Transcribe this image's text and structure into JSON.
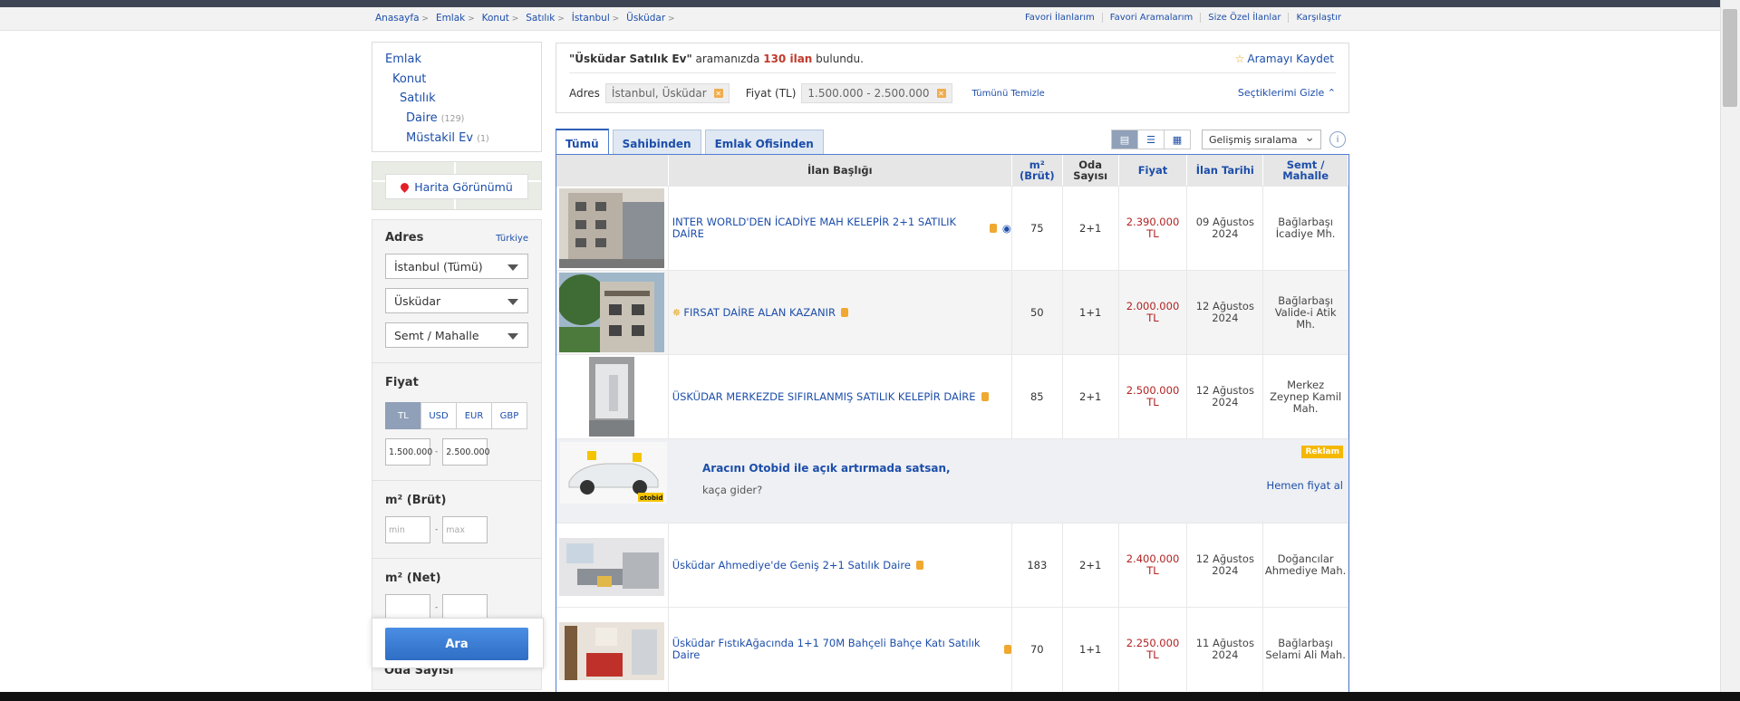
{
  "breadcrumbs": [
    "Anasayfa",
    "Emlak",
    "Konut",
    "Satılık",
    "İstanbul",
    "Üsküdar"
  ],
  "top_links": [
    "Favori İlanlarım",
    "Favori Aramalarım",
    "Size Özel İlanlar",
    "Karşılaştır"
  ],
  "sidebar": {
    "categories": [
      {
        "label": "Emlak",
        "count": ""
      },
      {
        "label": "Konut",
        "count": ""
      },
      {
        "label": "Satılık",
        "count": ""
      },
      {
        "label": "Daire",
        "count": "(129)"
      },
      {
        "label": "Müstakil Ev",
        "count": "(1)"
      }
    ],
    "map_button": "Harita Görünümü",
    "address_title": "Adres",
    "address_country_link": "Türkiye",
    "city_select": "İstanbul (Tümü)",
    "district_select": "Üsküdar",
    "neighborhood_select": "Semt / Mahalle",
    "price_title": "Fiyat",
    "currencies": [
      "TL",
      "USD",
      "EUR",
      "GBP"
    ],
    "active_currency": "TL",
    "price_min": "1.500.000",
    "price_max": "2.500.000",
    "m2_brut_title": "m² (Brüt)",
    "m2_min_placeholder": "min",
    "m2_max_placeholder": "max",
    "m2_net_title": "m² (Net)",
    "search_button": "Ara",
    "rooms_title": "Oda Sayısı"
  },
  "summary": {
    "query": "\"Üsküdar Satılık Ev\"",
    "text_before_count": " aramanızda ",
    "count": "130 ilan",
    "text_after_count": " bulundu.",
    "save_search": "Aramayı Kaydet",
    "address_label": "Adres",
    "address_chip": "İstanbul, Üsküdar",
    "price_label": "Fiyat (TL)",
    "price_chip": "1.500.000 - 2.500.000",
    "clear_all": "Tümünü Temizle",
    "hide_selections": "Seçtiklerimi Gizle"
  },
  "tabs": [
    "Tümü",
    "Sahibinden",
    "Emlak Ofisinden"
  ],
  "active_tab": "Tümü",
  "sort_select": "Gelişmiş sıralama",
  "table": {
    "headers": [
      "İlan Başlığı",
      "m² (Brüt)",
      "Oda Sayısı",
      "Fiyat",
      "İlan Tarihi",
      "Semt / Mahalle"
    ],
    "rows": [
      {
        "title": "INTER WORLD'DEN İCADİYE MAH KELEPİR 2+1 SATILIK DAİRE",
        "m2": "75",
        "rooms": "2+1",
        "price": "2.390.000 TL",
        "date1": "09 Ağustos",
        "date2": "2024",
        "loc1": "Bağlarbaşı",
        "loc2": "İcadiye Mh.",
        "loc3": ""
      },
      {
        "title": "FIRSAT DAİRE ALAN KAZANIR",
        "m2": "50",
        "rooms": "1+1",
        "price": "2.000.000 TL",
        "date1": "12 Ağustos",
        "date2": "2024",
        "loc1": "Bağlarbaşı",
        "loc2": "Valide-i Atik",
        "loc3": "Mh."
      },
      {
        "title": "ÜSKÜDAR MERKEZDE SIFIRLANMIŞ SATILIK KELEPİR DAİRE",
        "m2": "85",
        "rooms": "2+1",
        "price": "2.500.000 TL",
        "date1": "12 Ağustos",
        "date2": "2024",
        "loc1": "Merkez",
        "loc2": "Zeynep Kamil",
        "loc3": "Mah."
      },
      {
        "title": "Üsküdar Ahmediye'de Geniş 2+1 Satılık Daire",
        "m2": "183",
        "rooms": "2+1",
        "price": "2.400.000 TL",
        "date1": "12 Ağustos",
        "date2": "2024",
        "loc1": "Doğancılar",
        "loc2": "Ahmediye Mah.",
        "loc3": ""
      },
      {
        "title": "Üsküdar FıstıkAğacında 1+1 70M Bahçeli Bahçe Katı Satılık Daire",
        "m2": "70",
        "rooms": "1+1",
        "price": "2.250.000 TL",
        "date1": "11 Ağustos",
        "date2": "2024",
        "loc1": "Bağlarbaşı",
        "loc2": "Selami Ali Mah.",
        "loc3": ""
      }
    ]
  },
  "ad": {
    "title": "Aracını Otobid ile açık artırmada satsan,",
    "subtitle": "kaça gider?",
    "badge": "Reklam",
    "link": "Hemen fiyat al",
    "brand": "otobid"
  },
  "colors": {
    "link": "#1d4eaa",
    "price": "#b22222",
    "accent_blue": "#4f7ed2",
    "search_button": "#3b7dd8"
  }
}
